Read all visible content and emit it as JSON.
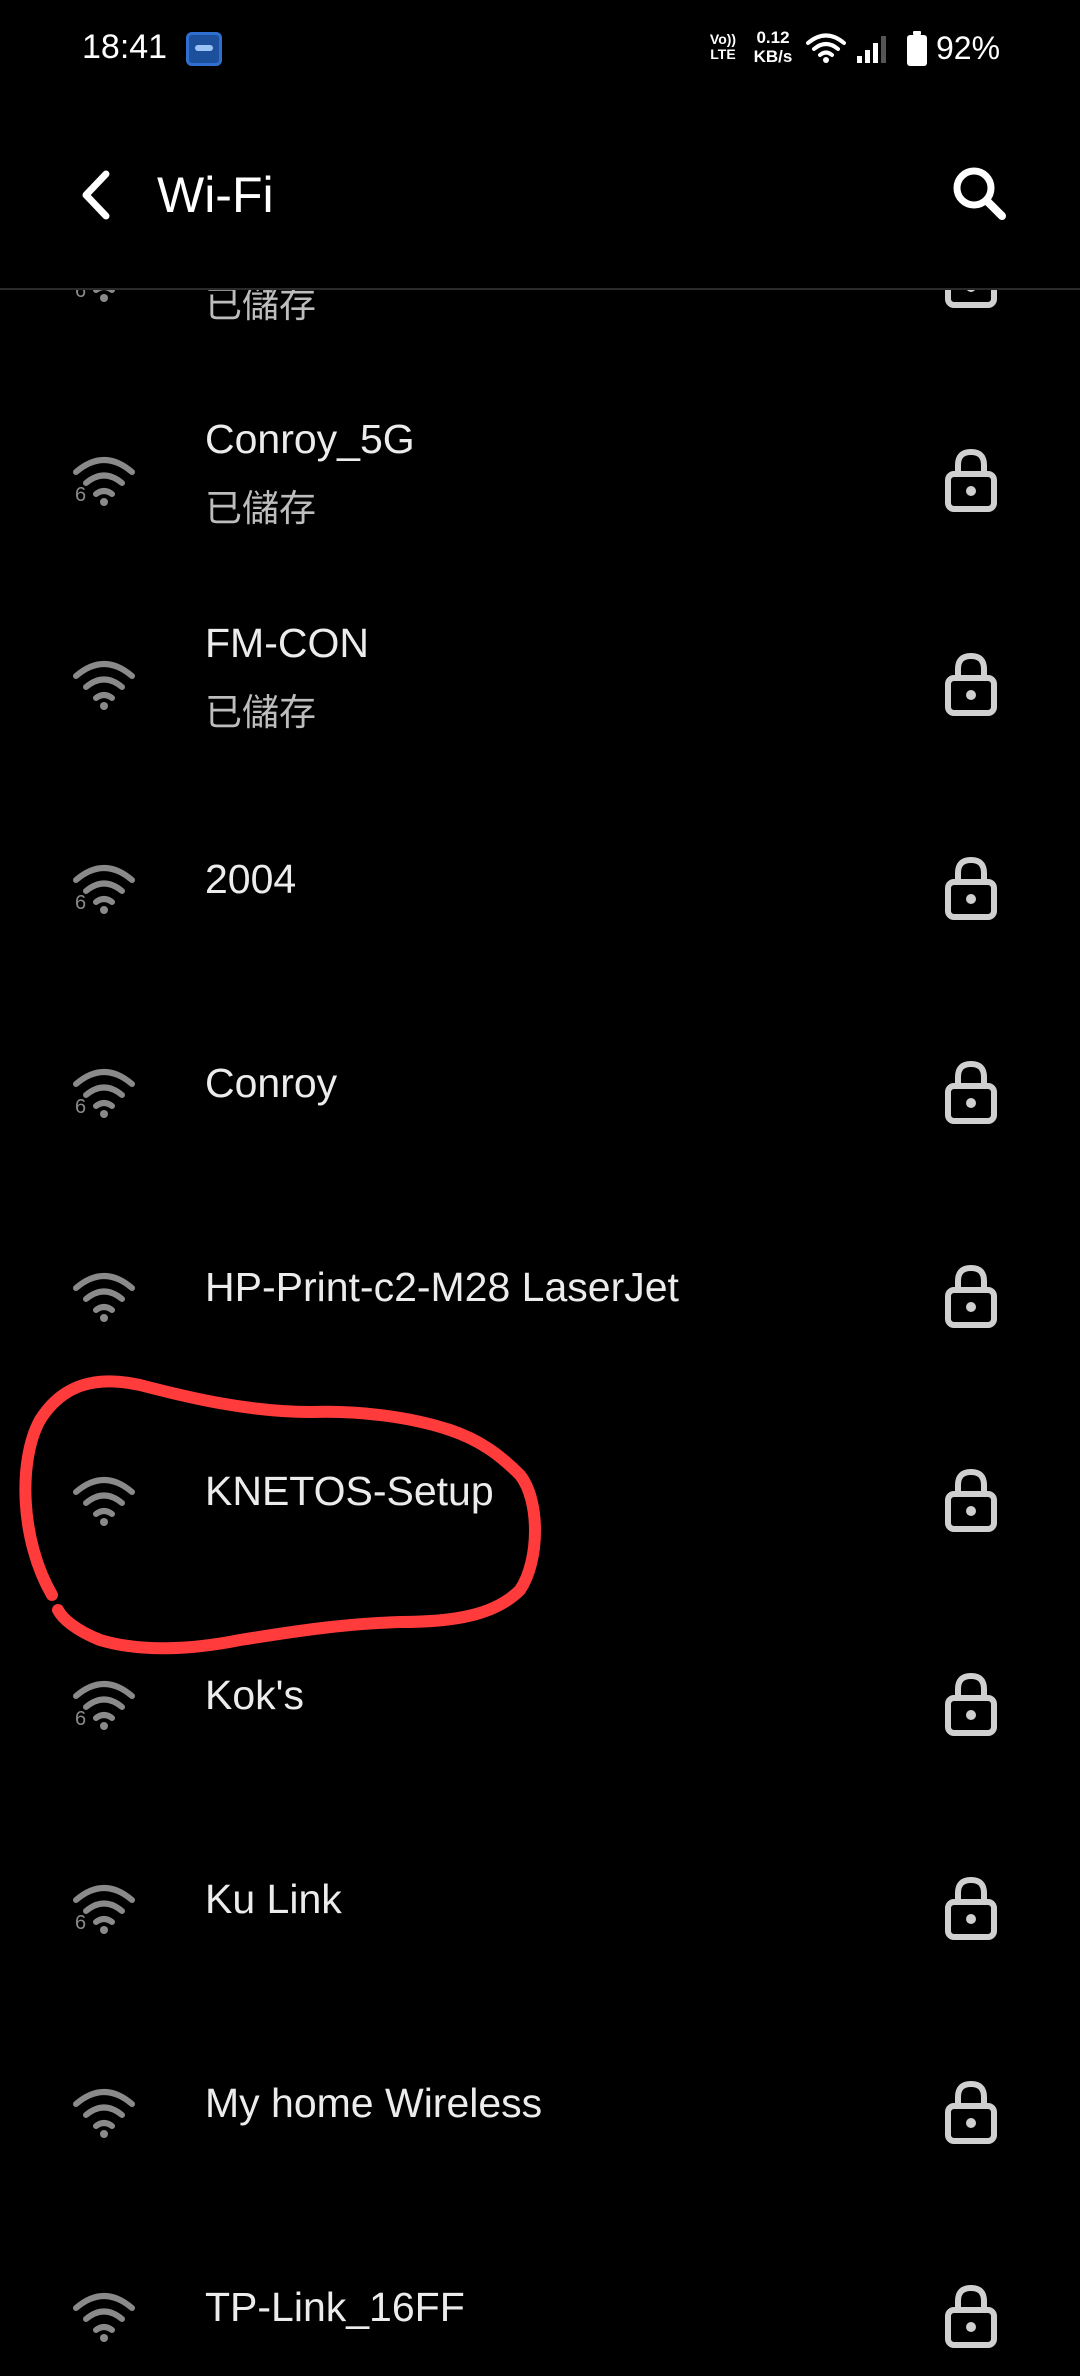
{
  "status_bar": {
    "time": "18:41",
    "app_icon": "app-notification-icon",
    "volte_top": "Vo))",
    "volte_bottom": "LTE",
    "speed_value": "0.12",
    "speed_unit": "KB/s",
    "wifi_icon": "wifi-status-icon",
    "signal_icon": "cell-signal-icon",
    "battery_icon": "battery-icon",
    "battery_pct": "92%"
  },
  "header": {
    "back_icon": "back-arrow-icon",
    "title": "Wi-Fi",
    "search_icon": "search-icon"
  },
  "networks": [
    {
      "name": "",
      "status": "已儲存",
      "wifi6": true,
      "locked": true,
      "cut_off_top": true
    },
    {
      "name": "Conroy_5G",
      "status": "已儲存",
      "wifi6": true,
      "locked": true
    },
    {
      "name": "FM-CON",
      "status": "已儲存",
      "wifi6": false,
      "locked": true
    },
    {
      "name": "2004",
      "status": "",
      "wifi6": true,
      "locked": true
    },
    {
      "name": "Conroy",
      "status": "",
      "wifi6": true,
      "locked": true
    },
    {
      "name": "HP-Print-c2-M28 LaserJet",
      "status": "",
      "wifi6": false,
      "locked": true
    },
    {
      "name": "KNETOS-Setup",
      "status": "",
      "wifi6": false,
      "locked": true,
      "annotated": true
    },
    {
      "name": "Kok's",
      "status": "",
      "wifi6": true,
      "locked": true
    },
    {
      "name": "Ku Link",
      "status": "",
      "wifi6": true,
      "locked": true
    },
    {
      "name": "My home Wireless",
      "status": "",
      "wifi6": false,
      "locked": true
    },
    {
      "name": "TP-Link_16FF",
      "status": "",
      "wifi6": false,
      "locked": true
    }
  ],
  "wifi6_badge": "6",
  "colors": {
    "background": "#000000",
    "text": "#ececec",
    "secondary_text": "#bdbdbd",
    "icon_grey": "#8a8a8a",
    "lock_grey": "#d0d0d0",
    "annotation": "#ff3b3b"
  }
}
